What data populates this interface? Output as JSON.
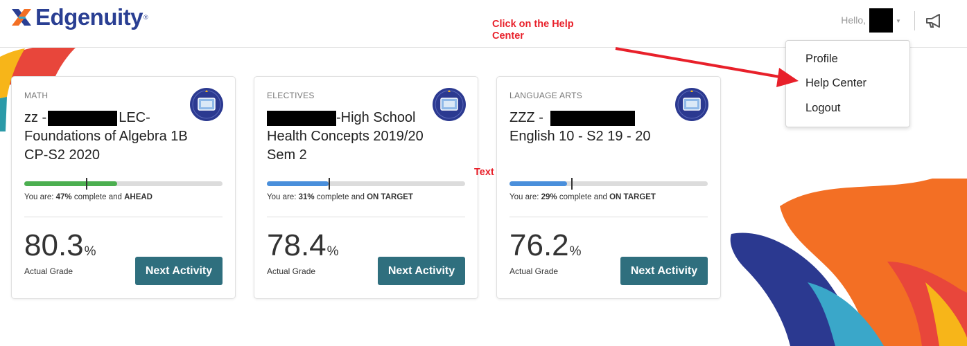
{
  "header": {
    "brand": "Edgenuity",
    "greeting": "Hello,",
    "icons": {
      "announcements": "megaphone-icon",
      "dropdown": "caret-down-icon"
    }
  },
  "annotation": {
    "help_center_note": "Click on the Help Center",
    "text_note": "Text",
    "color": "#e8202a"
  },
  "user_menu": {
    "items": [
      {
        "label": "Profile"
      },
      {
        "label": "Help Center"
      },
      {
        "label": "Logout"
      }
    ]
  },
  "courses": [
    {
      "subject": "MATH",
      "title_prefix": "zz -",
      "title_suffix": "LEC-",
      "title_rest": "Foundations of Algebra 1B CP-S2 2020",
      "progress_percent": 47,
      "target_percent": 31,
      "status_prefix": "You are: ",
      "percent_text": "47%",
      "status_mid": " complete and ",
      "status_word": "AHEAD",
      "grade": "80.3",
      "grade_unit": "%",
      "grade_label": "Actual Grade",
      "action_label": "Next Activity",
      "bar_color": "#4caf50"
    },
    {
      "subject": "ELECTIVES",
      "title_prefix": "",
      "title_suffix": "-High School",
      "title_rest": "Health Concepts 2019/20 Sem 2",
      "progress_percent": 31,
      "target_percent": 31,
      "status_prefix": "You are: ",
      "percent_text": "31%",
      "status_mid": " complete and ",
      "status_word": "ON TARGET",
      "grade": "78.4",
      "grade_unit": "%",
      "grade_label": "Actual Grade",
      "action_label": "Next Activity",
      "bar_color": "#4a8fdb"
    },
    {
      "subject": "LANGUAGE ARTS",
      "title_prefix": "ZZZ -",
      "title_suffix": "",
      "title_rest": "English 10 - S2 19 - 20",
      "progress_percent": 29,
      "target_percent": 31,
      "status_prefix": "You are: ",
      "percent_text": "29%",
      "status_mid": " complete and ",
      "status_word": "ON TARGET",
      "grade": "76.2",
      "grade_unit": "%",
      "grade_label": "Actual Grade",
      "action_label": "Next Activity",
      "bar_color": "#4a8fdb"
    }
  ],
  "colors": {
    "brand_blue": "#2a3f93",
    "button_teal": "#2f6f7e",
    "decor_orange": "#f36f24",
    "decor_navy": "#2b3990",
    "decor_teal": "#3aa7c9",
    "decor_yellow": "#f7b519",
    "decor_red": "#e8463b"
  }
}
